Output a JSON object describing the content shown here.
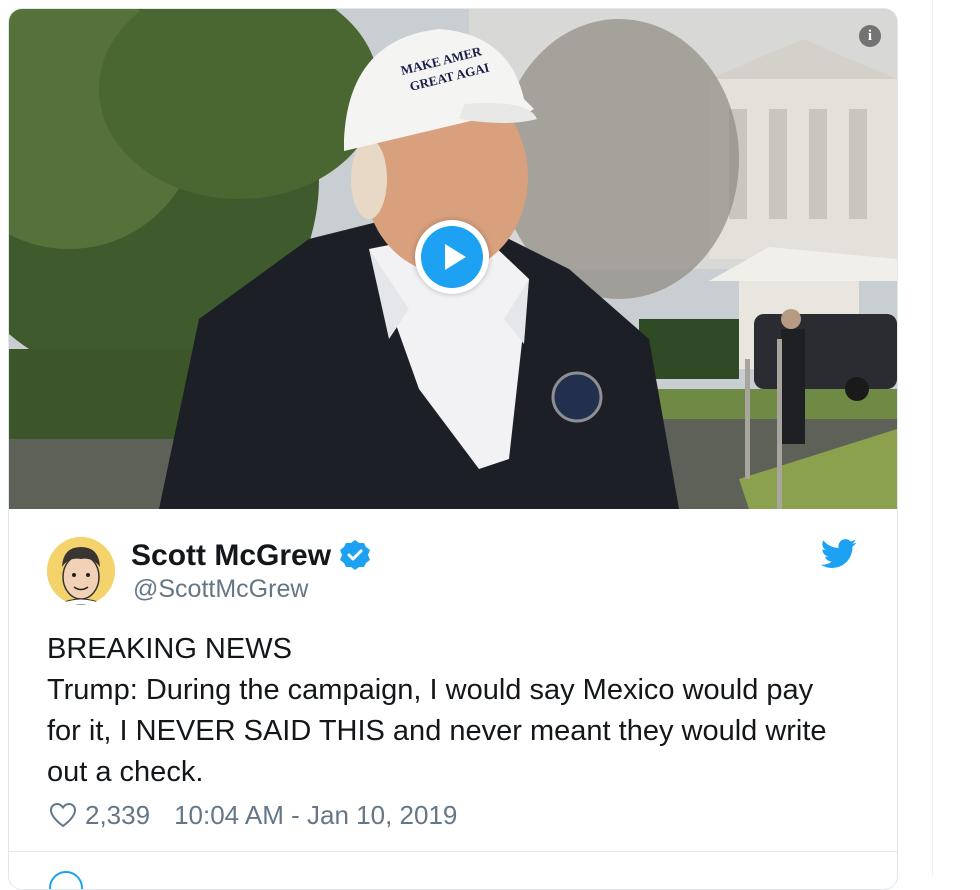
{
  "media": {
    "play_icon": "play-icon",
    "info_icon": "info-icon",
    "info_glyph": "i",
    "cap_text_line1": "MAKE AMER",
    "cap_text_line2": "GREAT AGAI"
  },
  "tweet": {
    "author_name": "Scott McGrew",
    "author_handle": "@ScottMcGrew",
    "verified_icon": "verified-badge-icon",
    "brand_icon": "twitter-bird-icon",
    "text_lines": [
      "BREAKING NEWS",
      "Trump:  During the campaign, I would say Mexico would pay",
      "for it, I NEVER SAID THIS and never meant they would write",
      "out a check."
    ],
    "like_count": "2,339",
    "timestamp": "10:04 AM - Jan 10, 2019"
  },
  "colors": {
    "accent": "#1da1f2",
    "text": "#14171a",
    "muted": "#657786",
    "border": "#e1e8ed"
  }
}
